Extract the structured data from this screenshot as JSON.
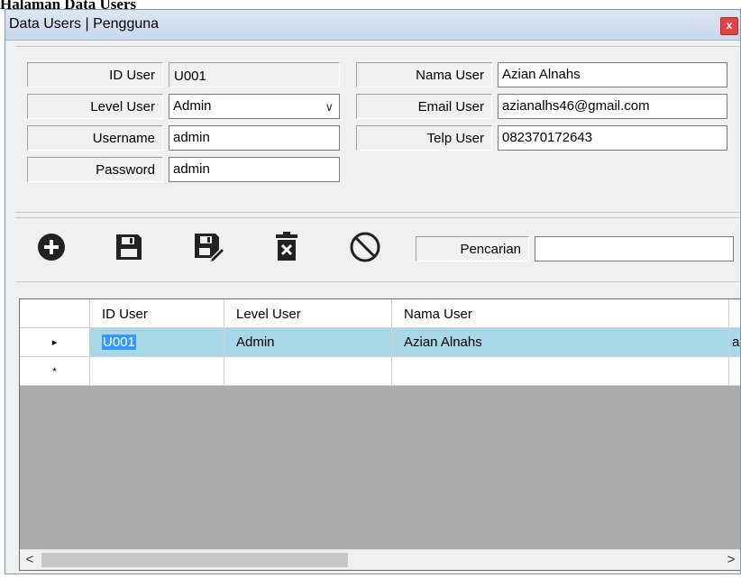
{
  "caption": "Halaman Data Users",
  "window": {
    "title": "Data Users | Pengguna",
    "close_label": "x"
  },
  "form": {
    "id_user_label": "ID User",
    "id_user_value": "U001",
    "level_user_label": "Level User",
    "level_user_value": "Admin",
    "username_label": "Username",
    "username_value": "admin",
    "password_label": "Password",
    "password_value": "admin",
    "nama_user_label": "Nama User",
    "nama_user_value": "Azian Alnahs",
    "email_user_label": "Email User",
    "email_user_value": "azianalhs46@gmail.com",
    "telp_user_label": "Telp User",
    "telp_user_value": "082370172643"
  },
  "toolbar": {
    "icons": [
      "add-icon",
      "save-icon",
      "save-edit-icon",
      "delete-icon",
      "cancel-icon"
    ],
    "search_label": "Pencarian",
    "search_value": ""
  },
  "grid": {
    "columns": [
      "ID User",
      "Level User",
      "Nama User"
    ],
    "rows": [
      {
        "marker": "▸",
        "id_user": "U001",
        "level_user": "Admin",
        "nama_user": "Azian Alnahs",
        "overflow": "a"
      }
    ],
    "new_row_marker": "*"
  },
  "scroll": {
    "left_arrow": "<",
    "right_arrow": ">"
  },
  "colors": {
    "selection": "#a8d8e8",
    "icon": "#222222"
  }
}
